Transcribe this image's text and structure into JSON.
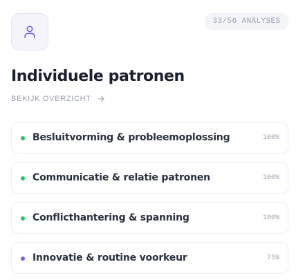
{
  "header": {
    "avatar_icon": "user-icon",
    "analyses_badge": "33/56 ANALYSES"
  },
  "section": {
    "title": "Individuele patronen",
    "overview_link": "BEKIJK OVERZICHT",
    "overview_icon": "arrow-right-icon"
  },
  "patterns": [
    {
      "label": "Besluitvorming & probleemoplossing",
      "percent": "100%",
      "dot_color": "#22c55e"
    },
    {
      "label": "Communicatie & relatie patronen",
      "percent": "100%",
      "dot_color": "#22c55e"
    },
    {
      "label": "Conflicthantering & spanning",
      "percent": "100%",
      "dot_color": "#22c55e"
    },
    {
      "label": "Innovatie & routine voorkeur",
      "percent": "75%",
      "dot_color": "#7c5ce6"
    }
  ],
  "colors": {
    "accent": "#7b5ce5",
    "complete": "#22c55e",
    "partial": "#7c5ce6"
  }
}
